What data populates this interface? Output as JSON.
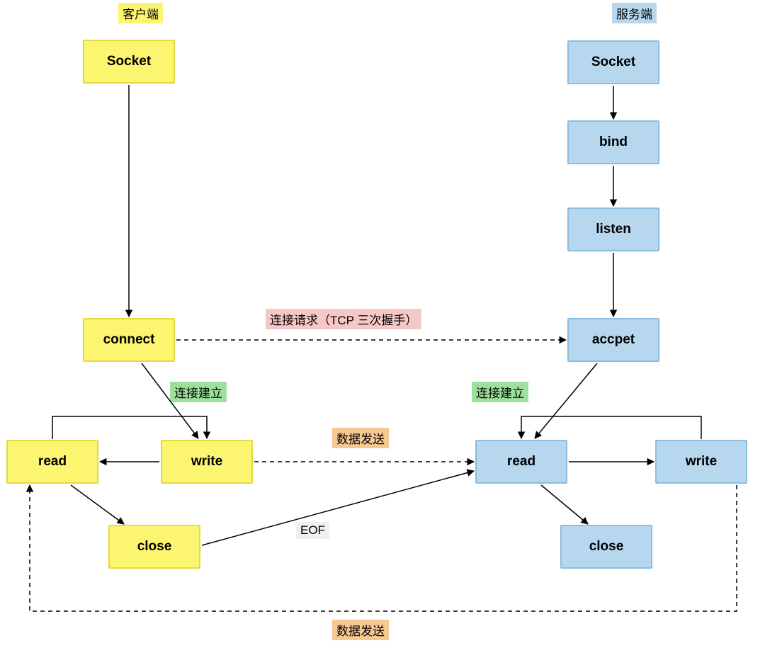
{
  "headers": {
    "client": "客户端",
    "server": "服务端"
  },
  "client_nodes": {
    "socket": "Socket",
    "connect": "connect",
    "read": "read",
    "write": "write",
    "close": "close"
  },
  "server_nodes": {
    "socket": "Socket",
    "bind": "bind",
    "listen": "listen",
    "accept": "accpet",
    "read": "read",
    "write": "write",
    "close": "close"
  },
  "edge_labels": {
    "connect_request": "连接请求（TCP 三次握手）",
    "connection_established_left": "连接建立",
    "connection_established_right": "连接建立",
    "data_send_mid": "数据发送",
    "data_send_bottom": "数据发送",
    "eof": "EOF"
  },
  "colors": {
    "client_fill": "#fcf56f",
    "server_fill": "#b7d7ef",
    "pink": "#f7c6c7",
    "green": "#9de09d",
    "orange": "#f7c890",
    "gray": "#f0f0f0"
  }
}
